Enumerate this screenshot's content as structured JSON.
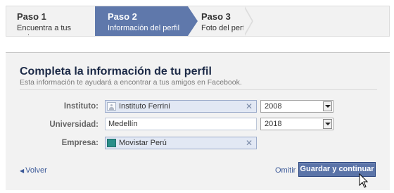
{
  "steps": [
    {
      "title": "Paso 1",
      "subtitle": "Encuentra a tus amigos"
    },
    {
      "title": "Paso 2",
      "subtitle": "Información del perfil"
    },
    {
      "title": "Paso 3",
      "subtitle": "Foto del perfil"
    }
  ],
  "active_step_index": 1,
  "header": {
    "title": "Completa la información de tu perfil",
    "subtitle": "Esta información te ayudará a encontrar a tus amigos en Facebook."
  },
  "form": {
    "school": {
      "label": "Instituto:",
      "value": "Instituto Ferrini",
      "year": "2008"
    },
    "university": {
      "label": "Universidad:",
      "value": "Medellín",
      "year": "2018"
    },
    "company": {
      "label": "Empresa:",
      "value": "Movistar Perú"
    }
  },
  "actions": {
    "back_label": "Volver",
    "skip_label": "Omitir",
    "separator": "·",
    "save_label": "Guardar y continuar"
  },
  "icons": {
    "back": "left-triangle-icon",
    "clear": "close-icon",
    "school_token": "person-silhouette-icon",
    "company_token": "company-logo-icon",
    "dropdown": "chevron-down-icon",
    "cursor": "mouse-pointer-icon"
  },
  "colors": {
    "active_step": "#5f78ab",
    "link": "#3b5998",
    "button": "#5b74a8",
    "token_bg": "#e2e8f4"
  }
}
